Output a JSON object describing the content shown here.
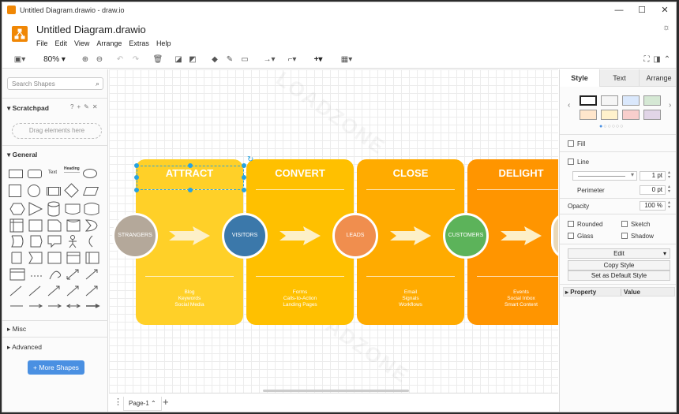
{
  "window": {
    "title": "Untitled Diagram.drawio - draw.io",
    "controls": {
      "minimize": "—",
      "maximize": "☐",
      "close": "✕"
    }
  },
  "document": {
    "title": "Untitled Diagram.drawio"
  },
  "menu": [
    "File",
    "Edit",
    "View",
    "Arrange",
    "Extras",
    "Help"
  ],
  "toolbar": {
    "zoom": "80%"
  },
  "left_panel": {
    "search_placeholder": "Search Shapes",
    "scratchpad_label": "Scratchpad",
    "drag_here": "Drag elements here",
    "general_label": "General",
    "misc_label": "Misc",
    "advanced_label": "Advanced",
    "more_shapes": "+ More Shapes",
    "text_shape": "Text",
    "heading_shape": "Heading"
  },
  "diagram": {
    "cards": [
      {
        "title": "ATTRACT",
        "color": "#ffd028",
        "items": [
          "Blog",
          "Keywords",
          "Social Media"
        ]
      },
      {
        "title": "CONVERT",
        "color": "#ffc000",
        "items": [
          "Forms",
          "Calls-to-Action",
          "Landing Pages"
        ]
      },
      {
        "title": "CLOSE",
        "color": "#ffab00",
        "items": [
          "Email",
          "Signals",
          "Workflows"
        ]
      },
      {
        "title": "DELIGHT",
        "color": "#ff9500",
        "items": [
          "Events",
          "Social Inbox",
          "Smart Content"
        ]
      }
    ],
    "circles": [
      {
        "label": "STRANGERS",
        "color": "#b4a89a"
      },
      {
        "label": "VISITORS",
        "color": "#3b78aa"
      },
      {
        "label": "LEADS",
        "color": "#f08e4e"
      },
      {
        "label": "CUSTOMERS",
        "color": "#5cb35a"
      }
    ],
    "selection_color": "#29a3e0"
  },
  "bottom_bar": {
    "page_tab": "Page-1"
  },
  "right_panel": {
    "tabs": [
      "Style",
      "Text",
      "Arrange"
    ],
    "active_tab": "Style",
    "swatches": [
      "#ffffff",
      "#f5f5f5",
      "#dae8fc",
      "#d5e8d4",
      "#ffe6cc",
      "#fff2cc",
      "#f8cecc",
      "#e1d5e7"
    ],
    "fill_label": "Fill",
    "line_label": "Line",
    "line_width": "1 pt",
    "perimeter_label": "Perimeter",
    "perimeter_value": "0 pt",
    "opacity_label": "Opacity",
    "opacity_value": "100 %",
    "rounded_label": "Rounded",
    "sketch_label": "Sketch",
    "glass_label": "Glass",
    "shadow_label": "Shadow",
    "edit_button": "Edit",
    "copy_style_button": "Copy Style",
    "set_default_button": "Set as Default Style",
    "property_header": "Property",
    "value_header": "Value"
  }
}
